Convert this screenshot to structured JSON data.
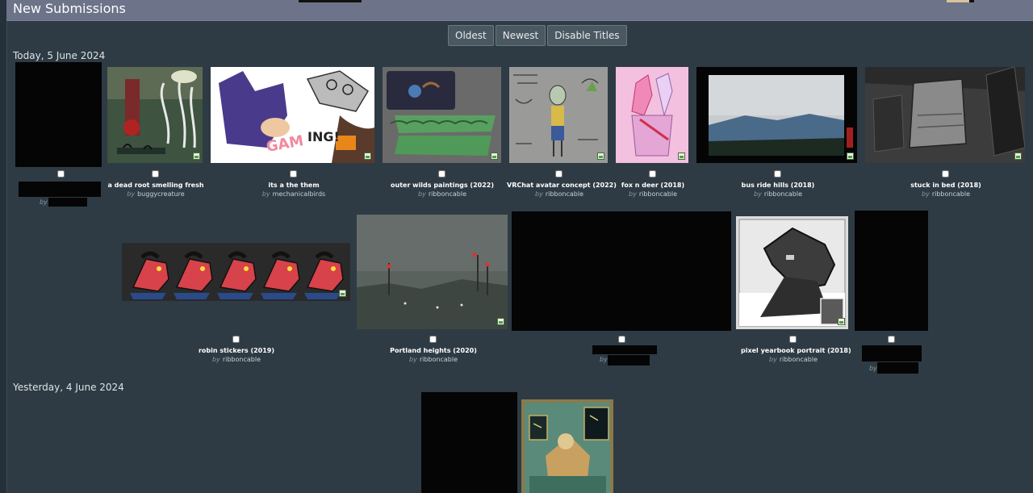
{
  "header": {
    "title": "New Submissions"
  },
  "sort": {
    "oldest": "Oldest",
    "newest": "Newest",
    "disable_titles": "Disable Titles"
  },
  "sections": {
    "today": "Today, 5 June 2024",
    "yesterday": "Yesterday, 4 June 2024"
  },
  "by_label": "by",
  "submissions": [
    {
      "title": "a dead root smelling fresh",
      "author": "buggycreature"
    },
    {
      "title": "its a the them",
      "author": "mechanicalbirds"
    },
    {
      "title": "outer wilds paintings (2022)",
      "author": "ribboncable"
    },
    {
      "title": "VRChat avatar concept (2022)",
      "author": "ribboncable"
    },
    {
      "title": "fox n deer (2018)",
      "author": "ribboncable"
    },
    {
      "title": "bus ride hills (2018)",
      "author": "ribboncable"
    },
    {
      "title": "stuck in bed (2018)",
      "author": "ribboncable"
    },
    {
      "title": "robin stickers (2019)",
      "author": "ribboncable"
    },
    {
      "title": "Portland heights (2020)",
      "author": "ribboncable"
    },
    {
      "title": "pixel yearbook portrait (2018)",
      "author": "ribboncable"
    }
  ]
}
